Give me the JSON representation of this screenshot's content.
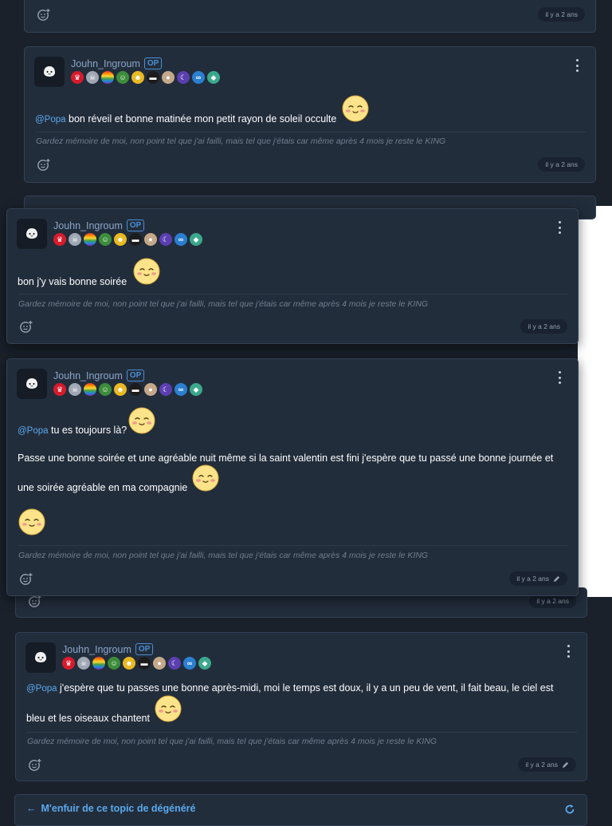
{
  "op_label": "OP",
  "signature": "Gardez mémoire de moi, non point tel que j'ai failli, mais tel que j'étais car même après 4 mois je reste le KING",
  "posts": [
    {
      "timestamp": "il y a 2 ans"
    },
    {
      "author": "Jouhn_Ingroum",
      "mention": "@Popa",
      "text": "bon réveil et bonne matinée mon petit rayon de soleil occulte",
      "timestamp": "il y a 2 ans"
    },
    {
      "author": "Jouhn_Ingroum",
      "text": "bon j'y vais bonne soirée",
      "timestamp": "il y a 2 ans"
    },
    {
      "author": "Jouhn_Ingroum",
      "mention": "@Popa",
      "line1": "tu es toujours là?",
      "line2": "Passe une bonne soirée et une agréable nuit même si la saint valentin est fini j'espère que tu passé une bonne journée et",
      "line3": "une soirée agréable en ma compagnie",
      "timestamp": "il y a 2 ans",
      "edited": true
    },
    {
      "timestamp": "il y a 2 ans"
    },
    {
      "author": "Jouhn_Ingroum",
      "mention": "@Popa",
      "line1": "j'espère que tu passes une bonne après-midi, moi le temps est doux, il y a un peu de vent, il fait beau, le ciel est",
      "line2": "bleu et les oiseaux chantent",
      "timestamp": "il y a 2 ans",
      "edited": true
    }
  ],
  "footer": {
    "flee_label": "M'enfuir de ce topic de dégénéré"
  },
  "icons": [
    "ghost-avatar-icon",
    "kebab-menu-icon",
    "add-reaction-icon",
    "pencil-icon",
    "arrow-left-icon",
    "refresh-icon",
    "blush-emoji-icon"
  ],
  "colors": {
    "background": "#1a212b",
    "card": "#222d3b",
    "link": "#5aa9ee",
    "op_border": "#4a8fd6"
  }
}
